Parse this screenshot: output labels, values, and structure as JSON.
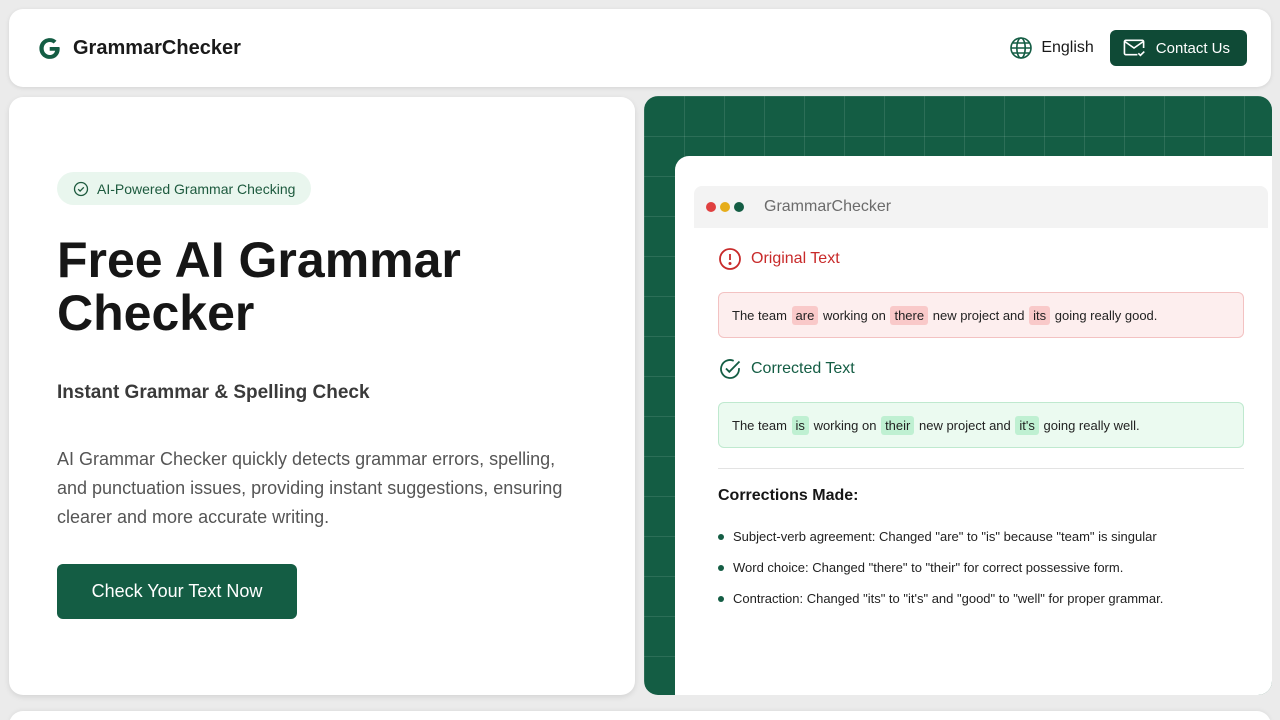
{
  "header": {
    "brand_name": "GrammarChecker",
    "language_label": "English",
    "contact_label": "Contact Us"
  },
  "hero": {
    "badge": "AI-Powered Grammar Checking",
    "title": "Free AI Grammar Checker",
    "subtitle": "Instant Grammar & Spelling Check",
    "description": "AI Grammar Checker quickly detects grammar errors, spelling, and punctuation issues, providing instant suggestions, ensuring clearer and more accurate writing.",
    "cta_label": "Check Your Text Now"
  },
  "demo": {
    "window_title": "GrammarChecker",
    "original_heading": "Original Text",
    "original_text": [
      {
        "t": "The team",
        "hl": false
      },
      {
        "t": "are",
        "hl": true
      },
      {
        "t": "working on",
        "hl": false
      },
      {
        "t": "there",
        "hl": true
      },
      {
        "t": "new project and",
        "hl": false
      },
      {
        "t": "its",
        "hl": true
      },
      {
        "t": "going really good.",
        "hl": false
      }
    ],
    "corrected_heading": "Corrected Text",
    "corrected_text": [
      {
        "t": "The team",
        "hl": false
      },
      {
        "t": "is",
        "hl": true
      },
      {
        "t": "working on",
        "hl": false
      },
      {
        "t": "their",
        "hl": true
      },
      {
        "t": "new project and",
        "hl": false
      },
      {
        "t": "it's",
        "hl": true
      },
      {
        "t": "going really well.",
        "hl": false
      }
    ],
    "corrections_title": "Corrections Made:",
    "corrections": [
      "Subject-verb agreement: Changed \"are\" to \"is\" because \"team\" is singular",
      "Word choice: Changed \"there\" to \"their\" for correct possessive form.",
      "Contraction: Changed \"its\" to \"it's\" and \"good\" to \"well\" for proper grammar."
    ]
  },
  "colors": {
    "brand_green": "#145d44",
    "dark_green": "#0f4a36",
    "error_red": "#c82a2a",
    "badge_bg": "#e9f6ee"
  },
  "icons": {
    "logo": "g-logo-icon",
    "language": "globe-icon",
    "contact": "mail-check-icon",
    "badge": "check-circle-icon",
    "original": "alert-circle-icon",
    "corrected": "check-circle-icon"
  }
}
